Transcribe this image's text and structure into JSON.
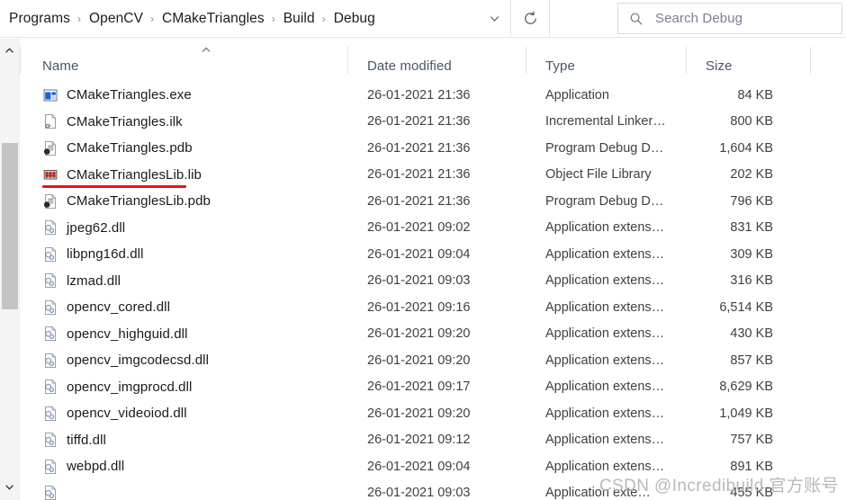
{
  "addressbar": {
    "crumbs": [
      "Programs",
      "OpenCV",
      "CMakeTriangles",
      "Build",
      "Debug"
    ],
    "separator": "›",
    "chevron_icon": "chevron-down-icon",
    "refresh_icon": "refresh-icon"
  },
  "search": {
    "placeholder": "Search Debug",
    "icon": "search-icon"
  },
  "scrollbar": {
    "up_icon": "chevron-up-icon",
    "down_icon": "chevron-down-icon"
  },
  "columns": {
    "name": "Name",
    "date_modified": "Date modified",
    "type": "Type",
    "size": "Size",
    "sort_caret_icon": "sort-ascending-caret-icon"
  },
  "annotation": {
    "color": "#ee1111",
    "target_row_index": 3
  },
  "watermark": "CSDN @Incredibuild 官方账号",
  "files": [
    {
      "name": "CMakeTriangles.exe",
      "date": "26-01-2021 21:36",
      "type": "Application",
      "size": "84 KB",
      "icon": "application-exe-icon"
    },
    {
      "name": "CMakeTriangles.ilk",
      "date": "26-01-2021 21:36",
      "type": "Incremental Linker…",
      "size": "800 KB",
      "icon": "incremental-linker-file-icon"
    },
    {
      "name": "CMakeTriangles.pdb",
      "date": "26-01-2021 21:36",
      "type": "Program Debug D…",
      "size": "1,604 KB",
      "icon": "program-debug-database-icon"
    },
    {
      "name": "CMakeTrianglesLib.lib",
      "date": "26-01-2021 21:36",
      "type": "Object File Library",
      "size": "202 KB",
      "icon": "object-file-library-icon"
    },
    {
      "name": "CMakeTrianglesLib.pdb",
      "date": "26-01-2021 21:36",
      "type": "Program Debug D…",
      "size": "796 KB",
      "icon": "program-debug-database-icon"
    },
    {
      "name": "jpeg62.dll",
      "date": "26-01-2021 09:02",
      "type": "Application extens…",
      "size": "831 KB",
      "icon": "application-extension-dll-icon"
    },
    {
      "name": "libpng16d.dll",
      "date": "26-01-2021 09:04",
      "type": "Application extens…",
      "size": "309 KB",
      "icon": "application-extension-dll-icon"
    },
    {
      "name": "lzmad.dll",
      "date": "26-01-2021 09:03",
      "type": "Application extens…",
      "size": "316 KB",
      "icon": "application-extension-dll-icon"
    },
    {
      "name": "opencv_cored.dll",
      "date": "26-01-2021 09:16",
      "type": "Application extens…",
      "size": "6,514 KB",
      "icon": "application-extension-dll-icon"
    },
    {
      "name": "opencv_highguid.dll",
      "date": "26-01-2021 09:20",
      "type": "Application extens…",
      "size": "430 KB",
      "icon": "application-extension-dll-icon"
    },
    {
      "name": "opencv_imgcodecsd.dll",
      "date": "26-01-2021 09:20",
      "type": "Application extens…",
      "size": "857 KB",
      "icon": "application-extension-dll-icon"
    },
    {
      "name": "opencv_imgprocd.dll",
      "date": "26-01-2021 09:17",
      "type": "Application extens…",
      "size": "8,629 KB",
      "icon": "application-extension-dll-icon"
    },
    {
      "name": "opencv_videoiod.dll",
      "date": "26-01-2021 09:20",
      "type": "Application extens…",
      "size": "1,049 KB",
      "icon": "application-extension-dll-icon"
    },
    {
      "name": "tiffd.dll",
      "date": "26-01-2021 09:12",
      "type": "Application extens…",
      "size": "757 KB",
      "icon": "application-extension-dll-icon"
    },
    {
      "name": "webpd.dll",
      "date": "26-01-2021 09:04",
      "type": "Application extens…",
      "size": "891 KB",
      "icon": "application-extension-dll-icon"
    },
    {
      "name": "",
      "date": "26-01-2021 09:03",
      "type": "Application exte…",
      "size": "455 KB",
      "icon": "application-extension-dll-icon"
    }
  ]
}
